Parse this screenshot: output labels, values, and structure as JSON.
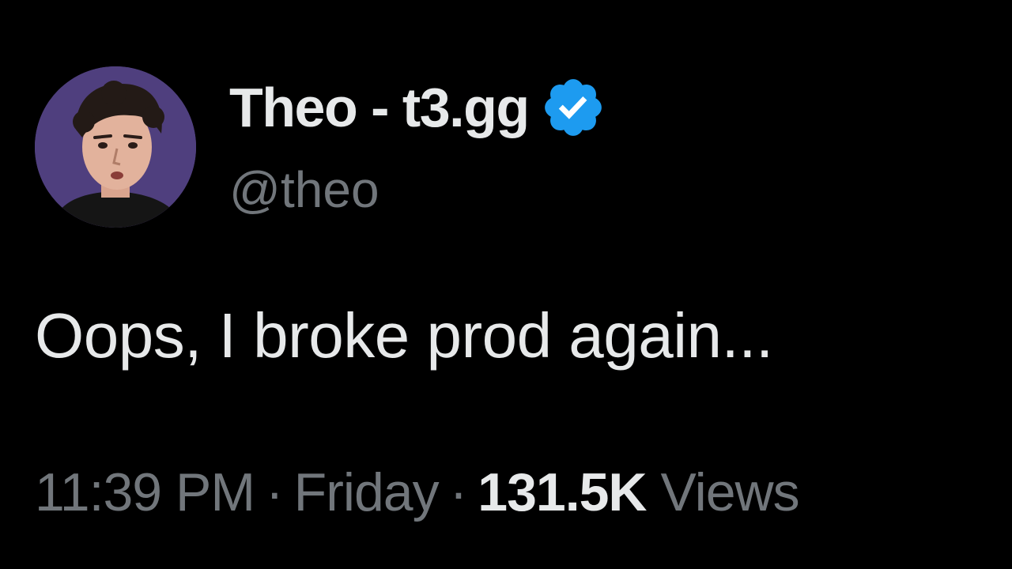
{
  "author": {
    "display_name": "Theo - t3.gg",
    "handle": "@theo",
    "verified": true,
    "verified_color": "#1d9bf0",
    "avatar_icon": "profile-photo"
  },
  "tweet": {
    "text": "Oops, I broke prod again..."
  },
  "meta": {
    "time": "11:39 PM",
    "separator": "·",
    "day": "Friday",
    "views_count": "131.5K",
    "views_label": "Views"
  }
}
